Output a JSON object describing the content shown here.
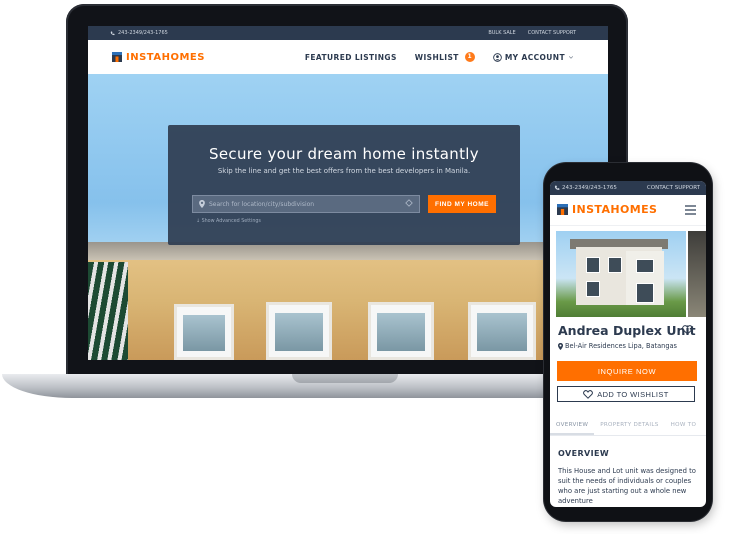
{
  "desktop": {
    "topbar": {
      "phone": "243-2349/243-1765",
      "links": [
        "BULK SALE",
        "CONTACT SUPPORT"
      ]
    },
    "brand": "INSTAHOMES",
    "nav": {
      "featured": "FEATURED LISTINGS",
      "wishlist": "WISHLIST",
      "wishlist_count": "1",
      "account": "MY ACCOUNT"
    },
    "hero": {
      "title": "Secure your dream home instantly",
      "subtitle": "Skip the line and get the best offers from the best developers in Manila.",
      "search_placeholder": "Search for location/city/subdivision",
      "button": "FIND MY HOME",
      "advanced": "Show Advanced Settings"
    }
  },
  "mobile": {
    "topbar": {
      "phone": "243-2349/243-1765",
      "support": "CONTACT SUPPORT"
    },
    "brand": "INSTAHOMES",
    "listing": {
      "title": "Andrea Duplex Unit",
      "location": "Bel-Air Residences Lipa, Batangas",
      "inquire": "INQUIRE NOW",
      "wishlist": "ADD TO WISHLIST"
    },
    "tabs": [
      "OVERVIEW",
      "PROPERTY DETAILS",
      "HOW TO"
    ],
    "overview": {
      "heading": "OVERVIEW",
      "text": "This House and Lot unit was designed to suit the needs of individuals or couples who are just starting out a whole new adventure"
    }
  },
  "colors": {
    "brand_orange": "#ff6f00",
    "navy": "#2c3a4f"
  },
  "icons": [
    "phone-icon",
    "home-logo-icon",
    "user-icon",
    "chevron-down-icon",
    "location-pin-icon",
    "clear-icon",
    "down-arrow-icon",
    "heart-icon",
    "menu-icon"
  ]
}
